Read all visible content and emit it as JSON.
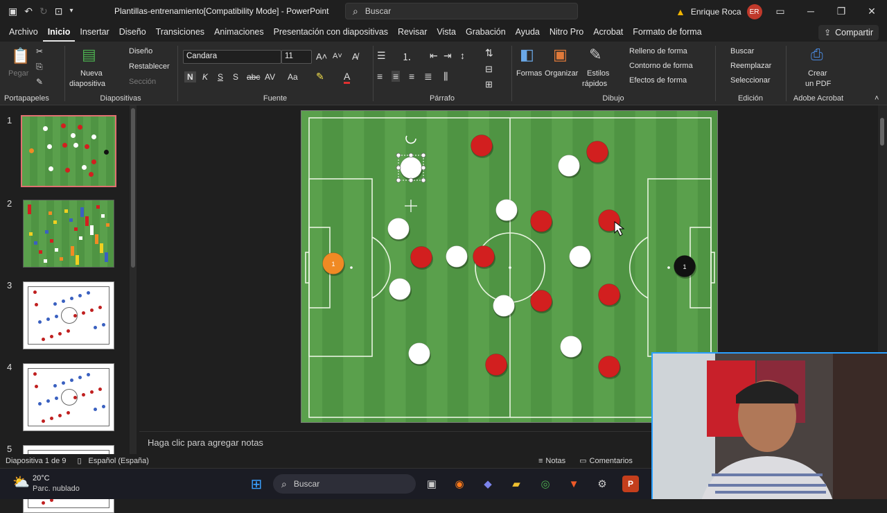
{
  "app": {
    "doc_title": "Plantillas-entrenamiento[Compatibility Mode]  -  PowerPoint",
    "search_placeholder": "Buscar",
    "user_name": "Enrique Roca",
    "user_initials": "ER",
    "share_label": "Compartir"
  },
  "tabs": [
    "Archivo",
    "Inicio",
    "Insertar",
    "Diseño",
    "Transiciones",
    "Animaciones",
    "Presentación con diapositivas",
    "Revisar",
    "Vista",
    "Grabación",
    "Ayuda",
    "Nitro Pro",
    "Acrobat",
    "Formato de forma"
  ],
  "active_tab": "Inicio",
  "ribbon": {
    "portapapeles": {
      "label": "Portapapeles",
      "pegar": "Pegar"
    },
    "diapositivas": {
      "label": "Diapositivas",
      "nueva": "Nueva",
      "nueva2": "diapositiva",
      "diseno": "Diseño",
      "restablecer": "Restablecer",
      "seccion": "Sección"
    },
    "fuente": {
      "label": "Fuente",
      "font": "Candara",
      "size": "11",
      "bold": "N",
      "italic": "K",
      "underline": "S",
      "strike": "S"
    },
    "parrafo": {
      "label": "Párrafo"
    },
    "dibujo": {
      "label": "Dibujo",
      "formas": "Formas",
      "organizar": "Organizar",
      "estilos": "Estilos",
      "estilos2": "rápidos",
      "relleno": "Relleno de forma",
      "contorno": "Contorno de forma",
      "efectos": "Efectos de forma"
    },
    "edicion": {
      "label": "Edición",
      "buscar": "Buscar",
      "reemplazar": "Reemplazar",
      "seleccionar": "Seleccionar"
    },
    "acrobat": {
      "label": "Adobe Acrobat",
      "crear": "Crear",
      "crear2": "un PDF"
    }
  },
  "thumbnails": [
    {
      "number": "1",
      "style": "field"
    },
    {
      "number": "2",
      "style": "field-drills"
    },
    {
      "number": "3",
      "style": "white-diagram"
    },
    {
      "number": "4",
      "style": "white-diagram"
    },
    {
      "number": "5",
      "style": "white-diagram"
    }
  ],
  "slide": {
    "colors": {
      "grass_light": "#5aa04c",
      "grass_dark": "#4f9443",
      "red": "#d21f1f",
      "white": "#ffffff",
      "orange": "#f08a24",
      "black": "#111111"
    },
    "keeper_left_number": "1",
    "keeper_right_number": "1"
  },
  "notes_placeholder": "Haga clic para agregar notas",
  "status": {
    "slide_info": "Diapositiva 1 de 9",
    "language": "Español (España)",
    "notes": "Notas",
    "comments": "Comentarios"
  },
  "taskbar": {
    "temp": "20°C",
    "weather": "Parc. nublado",
    "search": "Buscar"
  }
}
